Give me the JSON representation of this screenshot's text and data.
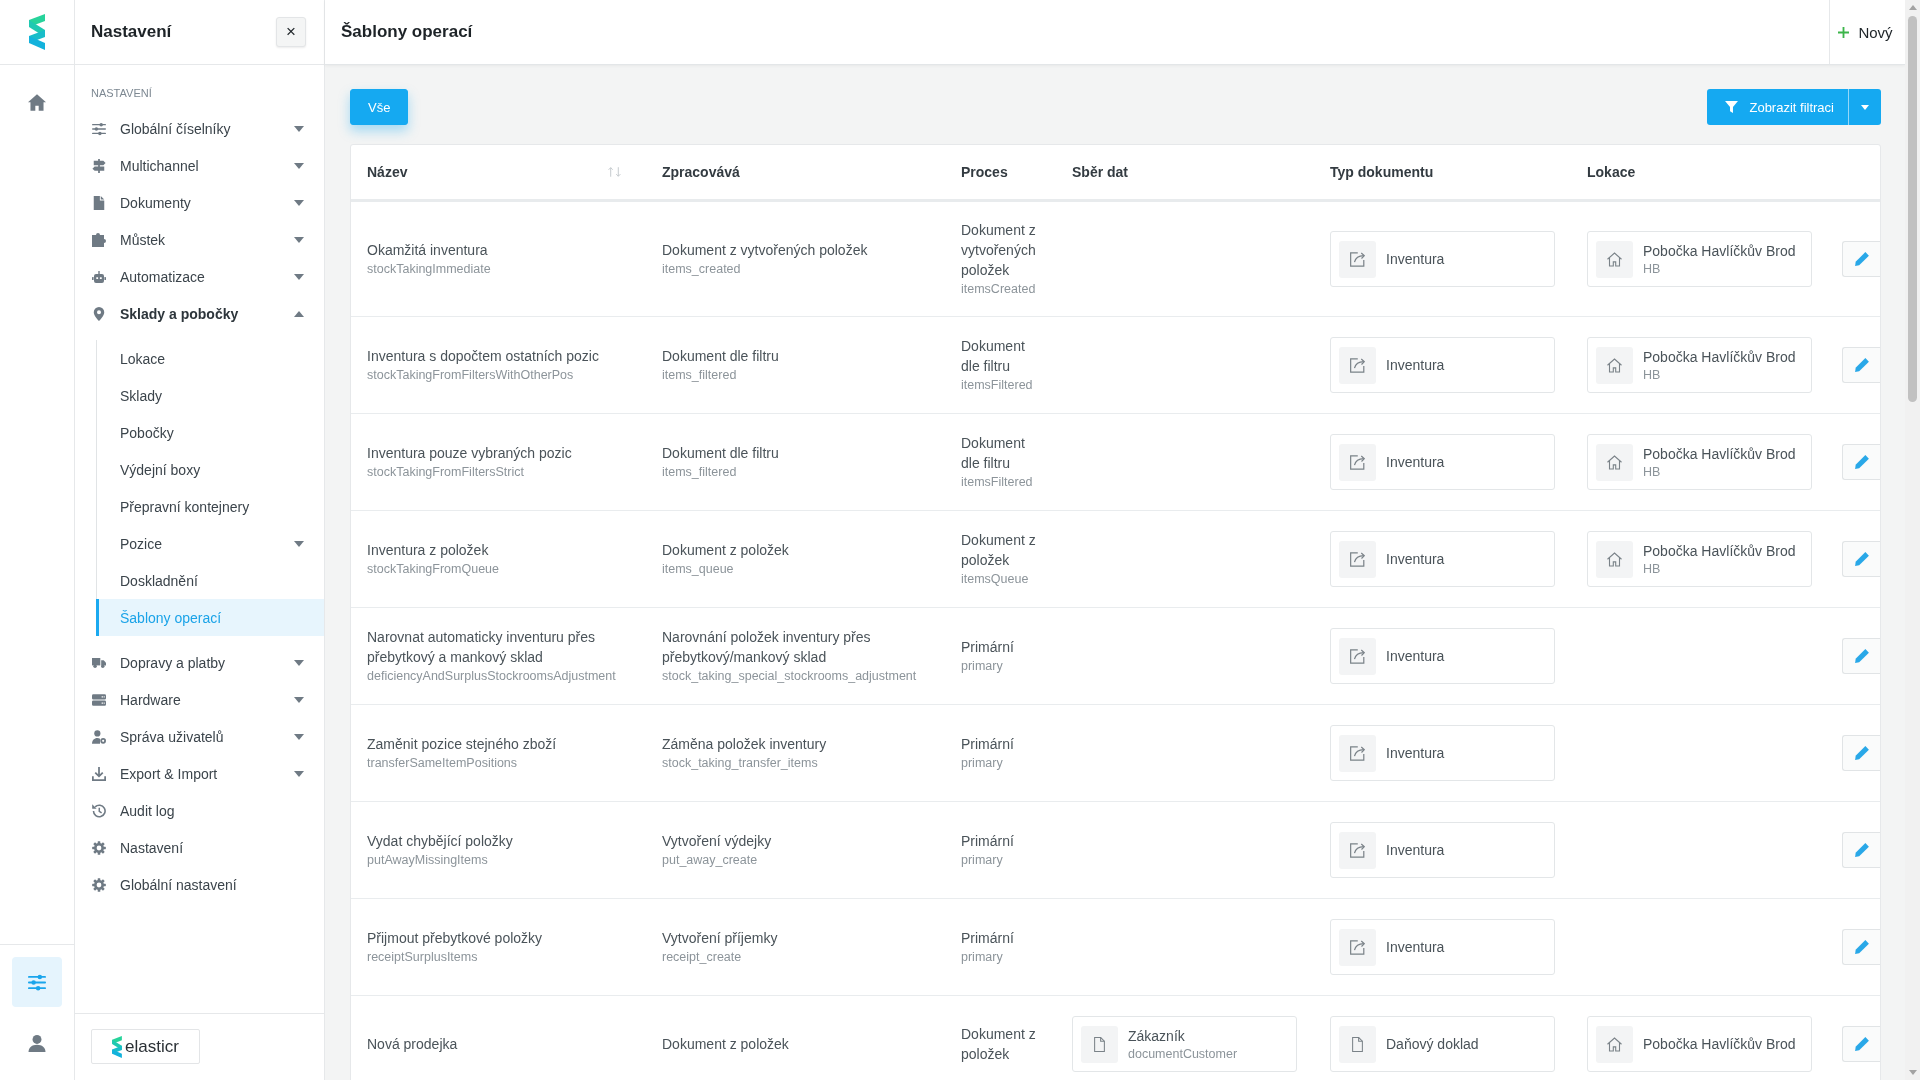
{
  "rail": {
    "top": [
      {
        "selected": false
      }
    ],
    "bottom": [
      {
        "selected": true
      },
      {
        "selected": false
      }
    ]
  },
  "nav": {
    "title": "Nastavení",
    "close": "×",
    "section_label": "NASTAVENÍ",
    "items": [
      {
        "kind": "group",
        "label": "Globální číselníky",
        "expanded": false,
        "selected": false
      },
      {
        "kind": "group",
        "label": "Multichannel",
        "expanded": false,
        "selected": false
      },
      {
        "kind": "group",
        "label": "Dokumenty",
        "expanded": false,
        "selected": false
      },
      {
        "kind": "group",
        "label": "Můstek",
        "expanded": false,
        "selected": false
      },
      {
        "kind": "group",
        "label": "Automatizace",
        "expanded": false,
        "selected": false
      },
      {
        "kind": "group",
        "label": "Sklady a pobočky",
        "expanded": true,
        "selected": false,
        "children": [
          {
            "kind": "link",
            "label": "Lokace",
            "selected": false
          },
          {
            "kind": "link",
            "label": "Sklady",
            "selected": false
          },
          {
            "kind": "link",
            "label": "Pobočky",
            "selected": false
          },
          {
            "kind": "link",
            "label": "Výdejní boxy",
            "selected": false
          },
          {
            "kind": "link",
            "label": "Přepravní kontejnery",
            "selected": false
          },
          {
            "kind": "group",
            "label": "Pozice",
            "expanded": false,
            "selected": false
          },
          {
            "kind": "link",
            "label": "Doskladnění",
            "selected": false
          },
          {
            "kind": "link",
            "label": "Šablony operací",
            "selected": true
          }
        ]
      },
      {
        "kind": "group",
        "label": "Dopravy a platby",
        "expanded": false,
        "selected": false
      },
      {
        "kind": "group",
        "label": "Hardware",
        "expanded": false,
        "selected": false
      },
      {
        "kind": "group",
        "label": "Správa uživatelů",
        "expanded": false,
        "selected": false
      },
      {
        "kind": "group",
        "label": "Export & Import",
        "expanded": false,
        "selected": false
      },
      {
        "kind": "link",
        "label": "Audit log",
        "selected": false
      },
      {
        "kind": "link",
        "label": "Nastavení",
        "selected": false
      },
      {
        "kind": "link",
        "label": "Globální nastavení",
        "selected": false
      }
    ],
    "brand": "elasticr"
  },
  "header": {
    "title": "Šablony operací",
    "new_button": "Nový"
  },
  "toolbar": {
    "tabs": [
      {
        "label": "Vše",
        "selected": true
      }
    ],
    "filter_button": "Zobrazit filtraci"
  },
  "table": {
    "columns": [
      {
        "label": "Název",
        "sortable": true
      },
      {
        "label": "Zpracovává",
        "sortable": false
      },
      {
        "label": "Proces",
        "sortable": false
      },
      {
        "label": "Sběr dat",
        "sortable": false
      },
      {
        "label": "Typ dokumentu",
        "sortable": false
      },
      {
        "label": "Lokace",
        "sortable": false
      }
    ],
    "rows": [
      {
        "name": "Okamžitá inventura",
        "code": "stockTakingImmediate",
        "processor": {
          "label": "Dokument z vytvořených položek",
          "code": "items_created"
        },
        "process": {
          "label": "Dokument z vytvořených položek",
          "code": "itemsCreated"
        },
        "document_type": {
          "kind": "stocktaking",
          "label": "Inventura"
        },
        "location": {
          "name": "Pobočka Havlíčkův Brod",
          "code": "HB"
        }
      },
      {
        "name": "Inventura s dopočtem ostatních pozic",
        "code": "stockTakingFromFiltersWithOtherPos",
        "processor": {
          "label": "Dokument dle filtru",
          "code": "items_filtered"
        },
        "process": {
          "label": "Dokument dle filtru",
          "code": "itemsFiltered"
        },
        "document_type": {
          "kind": "stocktaking",
          "label": "Inventura"
        },
        "location": {
          "name": "Pobočka Havlíčkův Brod",
          "code": "HB"
        }
      },
      {
        "name": "Inventura pouze vybraných pozic",
        "code": "stockTakingFromFiltersStrict",
        "processor": {
          "label": "Dokument dle filtru",
          "code": "items_filtered"
        },
        "process": {
          "label": "Dokument dle filtru",
          "code": "itemsFiltered"
        },
        "document_type": {
          "kind": "stocktaking",
          "label": "Inventura"
        },
        "location": {
          "name": "Pobočka Havlíčkův Brod",
          "code": "HB"
        }
      },
      {
        "name": "Inventura z položek",
        "code": "stockTakingFromQueue",
        "processor": {
          "label": "Dokument z položek",
          "code": "items_queue"
        },
        "process": {
          "label": "Dokument z položek",
          "code": "itemsQueue"
        },
        "document_type": {
          "kind": "stocktaking",
          "label": "Inventura"
        },
        "location": {
          "name": "Pobočka Havlíčkův Brod",
          "code": "HB"
        }
      },
      {
        "name": "Narovnat automaticky inventuru přes přebytkový a mankový sklad",
        "code": "deficiencyAndSurplusStockroomsAdjustment",
        "processor": {
          "label": "Narovnání položek inventury přes přebytkový/mankový sklad",
          "code": "stock_taking_special_stockrooms_adjustment"
        },
        "process": {
          "label": "Primární",
          "code": "primary"
        },
        "document_type": {
          "kind": "stocktaking",
          "label": "Inventura"
        }
      },
      {
        "name": "Zaměnit pozice stejného zboží",
        "code": "transferSameItemPositions",
        "processor": {
          "label": "Záměna položek inventury",
          "code": "stock_taking_transfer_items"
        },
        "process": {
          "label": "Primární",
          "code": "primary"
        },
        "document_type": {
          "kind": "stocktaking",
          "label": "Inventura"
        }
      },
      {
        "name": "Vydat chybějící položky",
        "code": "putAwayMissingItems",
        "processor": {
          "label": "Vytvoření výdejky",
          "code": "put_away_create"
        },
        "process": {
          "label": "Primární",
          "code": "primary"
        },
        "document_type": {
          "kind": "stocktaking",
          "label": "Inventura"
        }
      },
      {
        "name": "Přijmout přebytkové položky",
        "code": "receiptSurplusItems",
        "processor": {
          "label": "Vytvoření příjemky",
          "code": "receipt_create"
        },
        "process": {
          "label": "Primární",
          "code": "primary"
        },
        "document_type": {
          "kind": "stocktaking",
          "label": "Inventura"
        }
      },
      {
        "name": "Nová prodejka",
        "processor": {
          "label": "Dokument z položek"
        },
        "process": {
          "label": "Dokument z položek"
        },
        "data_collection": [
          {
            "label": "Zákazník",
            "code": "documentCustomer"
          }
        ],
        "document_type": {
          "kind": "invoice",
          "label": "Daňový doklad"
        },
        "location": {
          "name": "Pobočka Havlíčkův Brod"
        }
      }
    ]
  }
}
